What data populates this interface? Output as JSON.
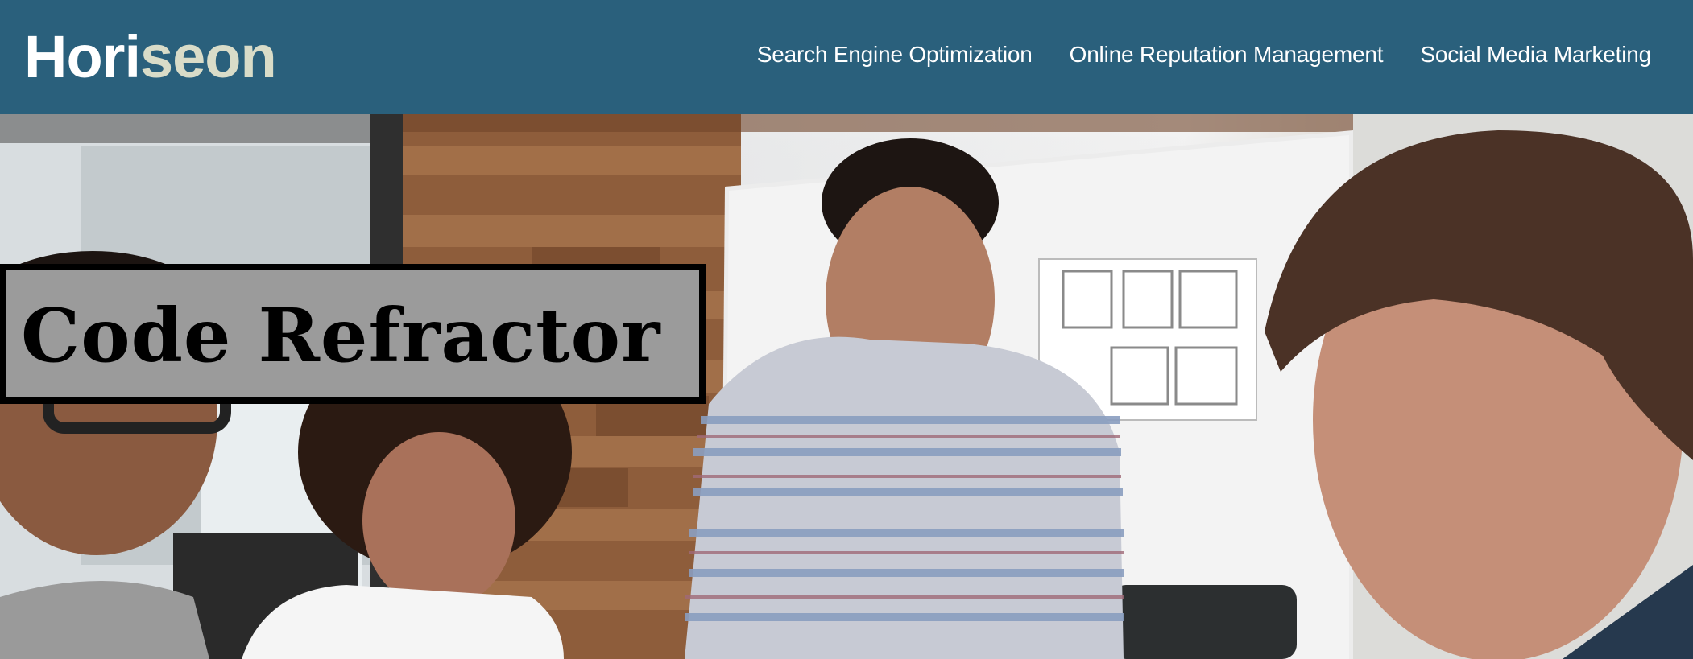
{
  "header": {
    "logo_main": "Hori",
    "logo_accent": "seon",
    "nav": [
      {
        "label": "Search Engine Optimization"
      },
      {
        "label": "Online Reputation Management"
      },
      {
        "label": "Social Media Marketing"
      }
    ]
  },
  "hero": {
    "title": "Code Refractor"
  },
  "colors": {
    "header_bg": "#2a607c",
    "logo_accent": "#d9dcc8",
    "title_box_bg": "#9b9b9b",
    "title_box_border": "#000000"
  }
}
